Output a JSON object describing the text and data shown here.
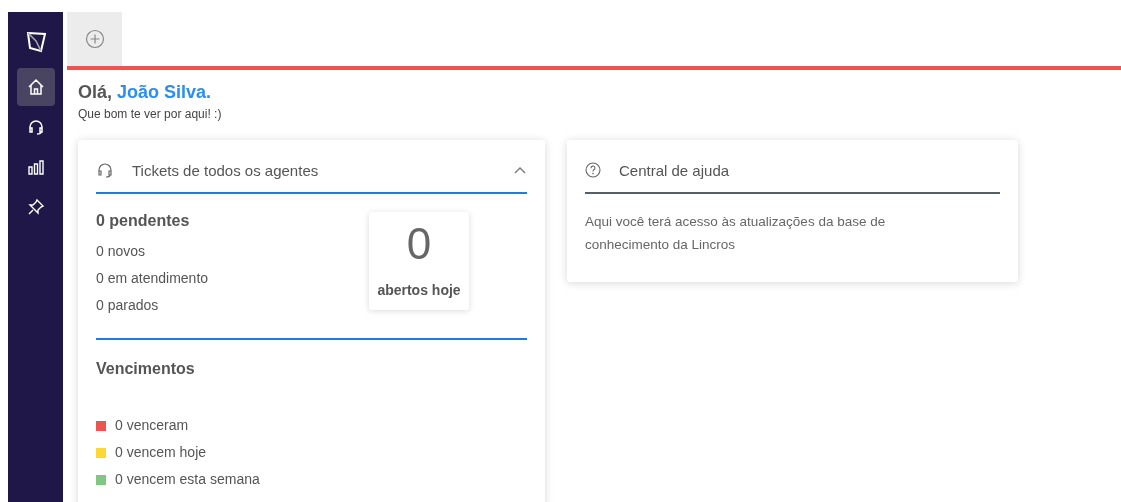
{
  "sidebar": {
    "items": [
      {
        "selected": true
      },
      {
        "selected": false
      },
      {
        "selected": false
      },
      {
        "selected": false
      }
    ]
  },
  "greeting": {
    "prefix": "Olá,",
    "name": "João Silva.",
    "subtitle": "Que bom te ver por aqui! :)"
  },
  "tickets_card": {
    "title": "Tickets de todos os agentes",
    "expanded": true,
    "pending": "0 pendentes",
    "stats": [
      "0 novos",
      "0 em atendimento",
      "0 parados"
    ],
    "opened_today": {
      "value": "0",
      "label": "abertos hoje"
    },
    "due_title": "Vencimentos",
    "due_items": [
      {
        "label": "0 venceram",
        "color": "#ef5350"
      },
      {
        "label": "0 vencem hoje",
        "color": "#fdd835"
      },
      {
        "label": "0 vencem esta semana",
        "color": "#81c784"
      }
    ]
  },
  "help_card": {
    "title": "Central de ajuda",
    "text": "Aqui você terá acesso às atualizações da base de conhecimento da Lincros"
  }
}
